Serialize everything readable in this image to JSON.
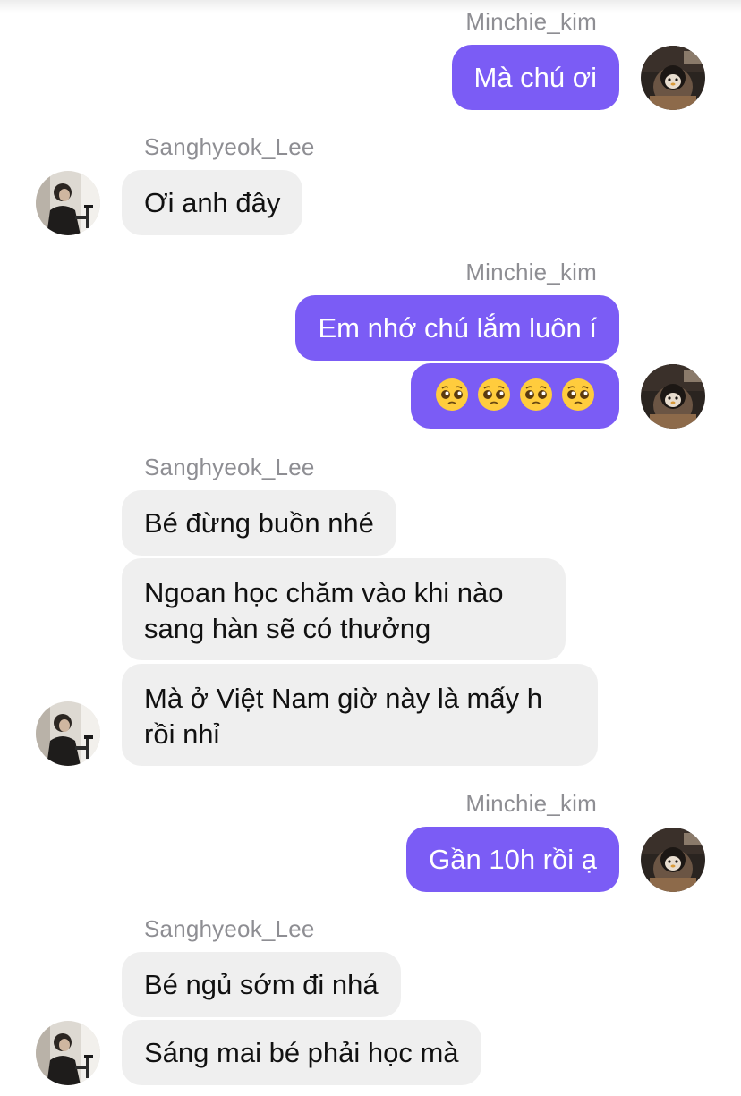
{
  "participants": {
    "me": "Minchie_kim",
    "other": "Sanghyeok_Lee"
  },
  "messages": [
    {
      "from": "me",
      "text": "Mà chú ơi"
    },
    {
      "from": "other",
      "text": "Ơi anh đây"
    },
    {
      "from": "me",
      "text": "Em nhớ chú lắm luôn í"
    },
    {
      "from": "me",
      "emoji": [
        "pleading-face",
        "pleading-face",
        "pleading-face",
        "pleading-face"
      ]
    },
    {
      "from": "other",
      "text": "Bé đừng buồn nhé"
    },
    {
      "from": "other",
      "text": "Ngoan học chăm vào khi nào sang hàn sẽ có thưởng"
    },
    {
      "from": "other",
      "text": "Mà ở Việt Nam giờ này là mấy h rồi nhỉ"
    },
    {
      "from": "me",
      "text": "Gần 10h rồi ạ"
    },
    {
      "from": "other",
      "text": "Bé ngủ sớm đi nhá"
    },
    {
      "from": "other",
      "text": "Sáng mai bé phải học mà"
    }
  ],
  "colors": {
    "outgoing_bubble": "#7b5cf5",
    "incoming_bubble": "#efefef",
    "username": "#8e8e93"
  }
}
